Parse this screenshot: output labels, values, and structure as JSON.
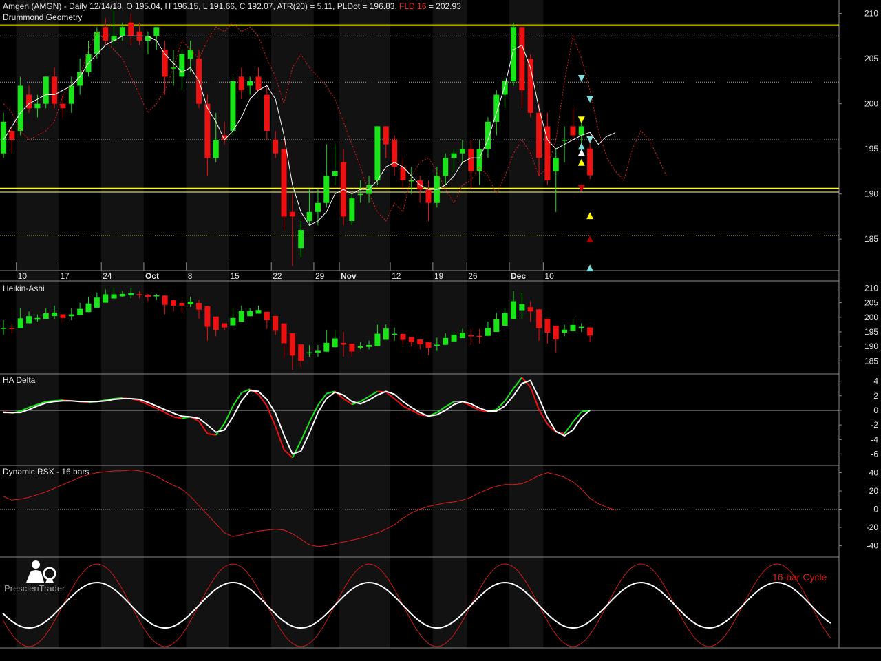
{
  "header": {
    "symbol": "Amgen (AMGN)",
    "line_rest": " - Daily 12/14/18, O 195.04, H 196.15, L 191.66, C 192.07, ATR(20) = 5.11, PLDot = 196.83, ",
    "fld_label": "FLD 16",
    "fld_value": " = 202.93"
  },
  "panels": {
    "main": "Drummond Geometry",
    "heikin": "Heikin-Ashi",
    "delta": "HA Delta",
    "rsx": "Dynamic RSX - 16 bars"
  },
  "logo": {
    "text": "PrescienTrader"
  },
  "cycle_label": "16-bar Cycle",
  "colors": {
    "up": "#19e619",
    "down": "#ee1111",
    "white": "#ffffff",
    "yellow": "#ffff00",
    "cyan": "#7fe0e0",
    "grid": "#4a4a4a"
  },
  "chart_data": [
    {
      "type": "candlestick",
      "title": "Drummond Geometry",
      "ylim": [
        181.5,
        211.5
      ],
      "yticks": [
        185,
        190,
        195,
        200,
        205,
        210
      ],
      "x_tick_labels": [
        "10",
        "17",
        "24",
        "Oct",
        "8",
        "15",
        "22",
        "29",
        "Nov",
        "12",
        "19",
        "26",
        "Dec",
        "10"
      ],
      "x_tick_index": [
        2,
        7,
        12,
        17,
        22,
        27,
        32,
        37,
        40,
        46,
        51,
        55,
        60,
        64
      ],
      "bars": [
        {
          "o": 194.5,
          "h": 199,
          "l": 194,
          "c": 198
        },
        {
          "o": 197,
          "h": 197.5,
          "l": 194.5,
          "c": 196
        },
        {
          "o": 197,
          "h": 203,
          "l": 196.5,
          "c": 202
        },
        {
          "o": 201,
          "h": 202,
          "l": 199,
          "c": 199.5
        },
        {
          "o": 199.5,
          "h": 201,
          "l": 198.5,
          "c": 200
        },
        {
          "o": 200,
          "h": 203,
          "l": 199.5,
          "c": 203
        },
        {
          "o": 203,
          "h": 204,
          "l": 199.5,
          "c": 200
        },
        {
          "o": 200,
          "h": 201,
          "l": 198.5,
          "c": 199.5
        },
        {
          "o": 200,
          "h": 203,
          "l": 199,
          "c": 202
        },
        {
          "o": 202,
          "h": 205,
          "l": 201,
          "c": 203.5
        },
        {
          "o": 203.5,
          "h": 207,
          "l": 203,
          "c": 205.5
        },
        {
          "o": 205.5,
          "h": 208.5,
          "l": 205,
          "c": 208
        },
        {
          "o": 208.5,
          "h": 209.5,
          "l": 206.5,
          "c": 207
        },
        {
          "o": 207,
          "h": 210.5,
          "l": 206.5,
          "c": 207.5
        },
        {
          "o": 207.5,
          "h": 209,
          "l": 207,
          "c": 208.5
        },
        {
          "o": 209,
          "h": 210,
          "l": 206.5,
          "c": 207.5
        },
        {
          "o": 208,
          "h": 209,
          "l": 206.5,
          "c": 207
        },
        {
          "o": 207,
          "h": 208,
          "l": 205.5,
          "c": 207.5
        },
        {
          "o": 207.5,
          "h": 208,
          "l": 206,
          "c": 208.5
        },
        {
          "o": 206,
          "h": 207,
          "l": 201,
          "c": 203
        },
        {
          "o": 204,
          "h": 206,
          "l": 202,
          "c": 204
        },
        {
          "o": 203,
          "h": 206,
          "l": 201.5,
          "c": 205.5
        },
        {
          "o": 205,
          "h": 207,
          "l": 203.5,
          "c": 206
        },
        {
          "o": 205,
          "h": 206,
          "l": 199.5,
          "c": 200
        },
        {
          "o": 200,
          "h": 201,
          "l": 192,
          "c": 194
        },
        {
          "o": 194,
          "h": 199,
          "l": 193.5,
          "c": 196
        },
        {
          "o": 196.5,
          "h": 198,
          "l": 195.5,
          "c": 196
        },
        {
          "o": 197,
          "h": 203,
          "l": 196.5,
          "c": 202.5
        },
        {
          "o": 203,
          "h": 204,
          "l": 200.5,
          "c": 201.5
        },
        {
          "o": 202,
          "h": 203,
          "l": 201,
          "c": 202.5
        },
        {
          "o": 203,
          "h": 204,
          "l": 201.5,
          "c": 201.5
        },
        {
          "o": 201,
          "h": 202,
          "l": 196,
          "c": 197
        },
        {
          "o": 196,
          "h": 197,
          "l": 194,
          "c": 194.5
        },
        {
          "o": 195,
          "h": 196,
          "l": 186,
          "c": 187.5
        },
        {
          "o": 188,
          "h": 190,
          "l": 182,
          "c": 187.5
        },
        {
          "o": 184,
          "h": 187,
          "l": 183,
          "c": 186
        },
        {
          "o": 187,
          "h": 190.5,
          "l": 186.5,
          "c": 188
        },
        {
          "o": 188,
          "h": 190.5,
          "l": 186.5,
          "c": 189
        },
        {
          "o": 189,
          "h": 195.5,
          "l": 188.5,
          "c": 192
        },
        {
          "o": 192,
          "h": 195.5,
          "l": 191,
          "c": 192.5
        },
        {
          "o": 193.5,
          "h": 195,
          "l": 186.5,
          "c": 187.5
        },
        {
          "o": 187,
          "h": 190,
          "l": 186.5,
          "c": 189.5
        },
        {
          "o": 190,
          "h": 191.5,
          "l": 189,
          "c": 190
        },
        {
          "o": 190,
          "h": 192,
          "l": 189,
          "c": 191
        },
        {
          "o": 191.5,
          "h": 197.5,
          "l": 191,
          "c": 197.5
        },
        {
          "o": 197.5,
          "h": 197.5,
          "l": 194,
          "c": 195.5
        },
        {
          "o": 196,
          "h": 196.5,
          "l": 192,
          "c": 193
        },
        {
          "o": 193,
          "h": 194,
          "l": 190.5,
          "c": 191.5
        },
        {
          "o": 191.5,
          "h": 193,
          "l": 190,
          "c": 191.5
        },
        {
          "o": 191.5,
          "h": 192,
          "l": 189,
          "c": 190.5
        },
        {
          "o": 190.5,
          "h": 191.5,
          "l": 187,
          "c": 189
        },
        {
          "o": 189,
          "h": 193,
          "l": 188.5,
          "c": 192
        },
        {
          "o": 192,
          "h": 194.5,
          "l": 191,
          "c": 194
        },
        {
          "o": 194,
          "h": 195,
          "l": 192.5,
          "c": 194.5
        },
        {
          "o": 194.5,
          "h": 196,
          "l": 193.5,
          "c": 195
        },
        {
          "o": 195,
          "h": 196,
          "l": 190.5,
          "c": 192.5
        },
        {
          "o": 192.5,
          "h": 196,
          "l": 191,
          "c": 195
        },
        {
          "o": 195,
          "h": 198.5,
          "l": 194,
          "c": 198
        },
        {
          "o": 198,
          "h": 201.5,
          "l": 196.5,
          "c": 201
        },
        {
          "o": 201,
          "h": 203,
          "l": 199.5,
          "c": 202.5
        },
        {
          "o": 202.5,
          "h": 209,
          "l": 202,
          "c": 208.5
        },
        {
          "o": 208.5,
          "h": 208.5,
          "l": 199.5,
          "c": 201.5
        },
        {
          "o": 205,
          "h": 205.5,
          "l": 198.5,
          "c": 199
        },
        {
          "o": 199,
          "h": 200,
          "l": 192,
          "c": 194
        },
        {
          "o": 197.5,
          "h": 199,
          "l": 191,
          "c": 191.5
        },
        {
          "o": 192.5,
          "h": 195,
          "l": 188,
          "c": 194
        },
        {
          "o": 196,
          "h": 197.5,
          "l": 193.5,
          "c": 196
        },
        {
          "o": 197.5,
          "h": 199.5,
          "l": 196,
          "c": 196.5
        },
        {
          "o": 196.5,
          "h": 198,
          "l": 195,
          "c": 197.5
        },
        {
          "o": 195.04,
          "h": 196.15,
          "l": 191.66,
          "c": 192.07
        }
      ],
      "pldot": [
        196,
        197.5,
        199,
        200,
        200.5,
        201,
        201,
        201.5,
        202,
        203,
        204.5,
        205.5,
        206.5,
        207,
        207.5,
        207.5,
        207.5,
        207.5,
        207,
        205.5,
        204.5,
        203.5,
        204,
        202.5,
        199.5,
        198,
        196,
        197,
        198.5,
        200.5,
        201.5,
        202,
        200.5,
        196.5,
        191,
        188,
        186.5,
        187,
        188,
        190,
        190.5,
        190,
        190.5,
        190.5,
        191.5,
        193,
        193.5,
        193,
        192,
        191,
        190.5,
        190.5,
        191,
        192,
        193.5,
        194,
        194,
        196,
        199,
        202,
        206,
        206.5,
        204,
        199.5,
        196,
        195,
        195.5,
        196,
        196.5,
        196.83
      ],
      "fld": [
        200,
        199,
        197,
        196,
        196.5,
        197,
        198,
        201,
        202,
        203,
        206,
        208,
        207,
        206,
        205,
        203,
        201,
        199,
        200,
        201.5,
        204,
        207,
        206,
        205,
        207,
        208.5,
        208,
        209,
        208,
        208.5,
        207.5,
        205,
        203,
        200,
        204,
        205.5,
        204,
        203,
        202,
        200.5,
        198,
        195.5,
        193,
        190,
        188,
        187,
        189,
        188,
        192,
        193.5,
        194,
        192.5,
        190.5,
        189,
        191,
        191.5,
        193,
        192,
        190,
        192,
        194.5,
        196,
        194.5,
        192,
        193,
        196,
        202.5,
        207.5,
        205,
        201.5,
        197,
        194,
        192.5,
        191.5,
        195,
        197,
        196,
        194,
        192
      ],
      "pldot_projection": [
        195.5,
        196.4,
        196.8
      ],
      "horizontal_levels": [
        {
          "value": 208.7,
          "style": "thick",
          "color": "#ffff00"
        },
        {
          "value": 207.5,
          "style": "dotted",
          "color": "#a6a6a6"
        },
        {
          "value": 202.4,
          "style": "dotted",
          "color": "#a6a6a6"
        },
        {
          "value": 196.0,
          "style": "dotted",
          "color": "#a6a6a6"
        },
        {
          "value": 190.6,
          "style": "thick",
          "color": "#ffff00"
        },
        {
          "value": 190.2,
          "style": "thin",
          "color": "#ffff99"
        },
        {
          "value": 185.4,
          "style": "dotted",
          "color": "#cccc66"
        }
      ],
      "markers": [
        {
          "x": 68,
          "y": 202.8,
          "shape": "down",
          "color": "#7fe0e0"
        },
        {
          "x": 68,
          "y": 198.2,
          "shape": "down",
          "color": "#ffff00"
        },
        {
          "x": 68,
          "y": 195.3,
          "shape": "up",
          "color": "#7fe0e0"
        },
        {
          "x": 68,
          "y": 194.6,
          "shape": "up",
          "color": "#ffffff"
        },
        {
          "x": 68,
          "y": 193.5,
          "shape": "up",
          "color": "#ffff00"
        },
        {
          "x": 68,
          "y": 190.6,
          "shape": "down",
          "color": "#cc0000"
        },
        {
          "x": 69,
          "y": 200.5,
          "shape": "down",
          "color": "#7fe0e0"
        },
        {
          "x": 69,
          "y": 196.0,
          "shape": "down",
          "color": "#7fe0e0"
        },
        {
          "x": 69,
          "y": 187.6,
          "shape": "up",
          "color": "#ffff00"
        },
        {
          "x": 69,
          "y": 185.0,
          "shape": "up",
          "color": "#aa0000"
        },
        {
          "x": 69,
          "y": 181.8,
          "shape": "up",
          "color": "#7fe0e0"
        }
      ]
    },
    {
      "type": "candlestick",
      "title": "Heikin-Ashi",
      "ylim": [
        182,
        212
      ],
      "yticks": [
        185,
        190,
        195,
        200,
        205,
        210
      ],
      "method": "heikin-ashi computed from main panel bars"
    },
    {
      "type": "line",
      "title": "HA Delta",
      "ylim": [
        -7,
        5
      ],
      "yticks": [
        4,
        2,
        0,
        -2,
        -4,
        -6
      ],
      "series": [
        {
          "values": [
            -0.2,
            -0.4,
            -0.1,
            0.4,
            0.8,
            1.2,
            1.3,
            1.4,
            1.3,
            1.2,
            1.1,
            1.2,
            1.4,
            1.6,
            1.7,
            1.6,
            1.3,
            0.8,
            0.3,
            -0.3,
            -0.9,
            -1.1,
            -0.9,
            -1.5,
            -3.2,
            -3.4,
            -1.8,
            0.6,
            2.4,
            2.9,
            2.2,
            0.6,
            -2.2,
            -5.4,
            -6.5,
            -4.2,
            -1.6,
            0.7,
            2.3,
            2.6,
            1.6,
            0.8,
            1.2,
            1.9,
            2.6,
            2.5,
            1.6,
            0.6,
            0.0,
            -0.6,
            -0.8,
            -0.3,
            0.5,
            1.2,
            1.2,
            0.6,
            0.0,
            -0.2,
            0.1,
            1.3,
            3.0,
            4.5,
            3.2,
            0.1,
            -1.9,
            -3.0,
            -3.2,
            -1.6,
            -0.2,
            0.0
          ]
        },
        {
          "values": [
            -0.3,
            -0.3,
            -0.3,
            0.1,
            0.6,
            1.0,
            1.2,
            1.3,
            1.3,
            1.2,
            1.2,
            1.2,
            1.3,
            1.5,
            1.6,
            1.6,
            1.5,
            1.1,
            0.6,
            0.1,
            -0.4,
            -0.8,
            -0.9,
            -1.1,
            -2.0,
            -3.0,
            -2.7,
            -0.9,
            1.3,
            2.7,
            2.6,
            1.5,
            -0.4,
            -3.4,
            -6.0,
            -5.6,
            -3.1,
            -0.3,
            1.6,
            2.5,
            2.1,
            1.2,
            0.9,
            1.4,
            2.1,
            2.6,
            2.2,
            1.2,
            0.4,
            -0.3,
            -0.8,
            -0.6,
            0.0,
            0.8,
            1.2,
            0.9,
            0.3,
            -0.1,
            -0.1,
            0.6,
            2.0,
            3.7,
            4.1,
            1.7,
            -1.0,
            -2.9,
            -3.5,
            -2.7,
            -1.0,
            0.0
          ]
        }
      ]
    },
    {
      "type": "line",
      "title": "Dynamic RSX - 16 bars",
      "ylim": [
        -48,
        48
      ],
      "yticks": [
        40,
        20,
        0,
        -20,
        -40
      ],
      "series": [
        {
          "values": [
            14,
            10,
            11,
            13,
            16,
            19,
            23,
            27,
            31,
            35,
            38,
            40,
            41,
            42,
            42,
            43,
            42,
            40,
            36,
            31,
            26,
            22,
            14,
            4,
            -6,
            -16,
            -26,
            -30,
            -28,
            -26,
            -24,
            -23,
            -22,
            -23,
            -27,
            -33,
            -39,
            -41,
            -40,
            -38,
            -36,
            -34,
            -32,
            -29,
            -26,
            -22,
            -17,
            -10,
            -4,
            0,
            3,
            5,
            7,
            8,
            10,
            13,
            18,
            22,
            25,
            27,
            27,
            28,
            32,
            37,
            40,
            38,
            35,
            30,
            22,
            12,
            6,
            2,
            -1
          ]
        }
      ]
    },
    {
      "type": "line",
      "title": "16-bar Cycle",
      "series": [
        {
          "period_bars": 16,
          "amplitude": 1.0,
          "peaks_at_bar": [
            11,
            27,
            43,
            59,
            75,
            91
          ]
        },
        {
          "period_bars": 16,
          "amplitude": 0.55,
          "peaks_at_bar": [
            11,
            27,
            43,
            59,
            75,
            91
          ]
        }
      ]
    }
  ]
}
